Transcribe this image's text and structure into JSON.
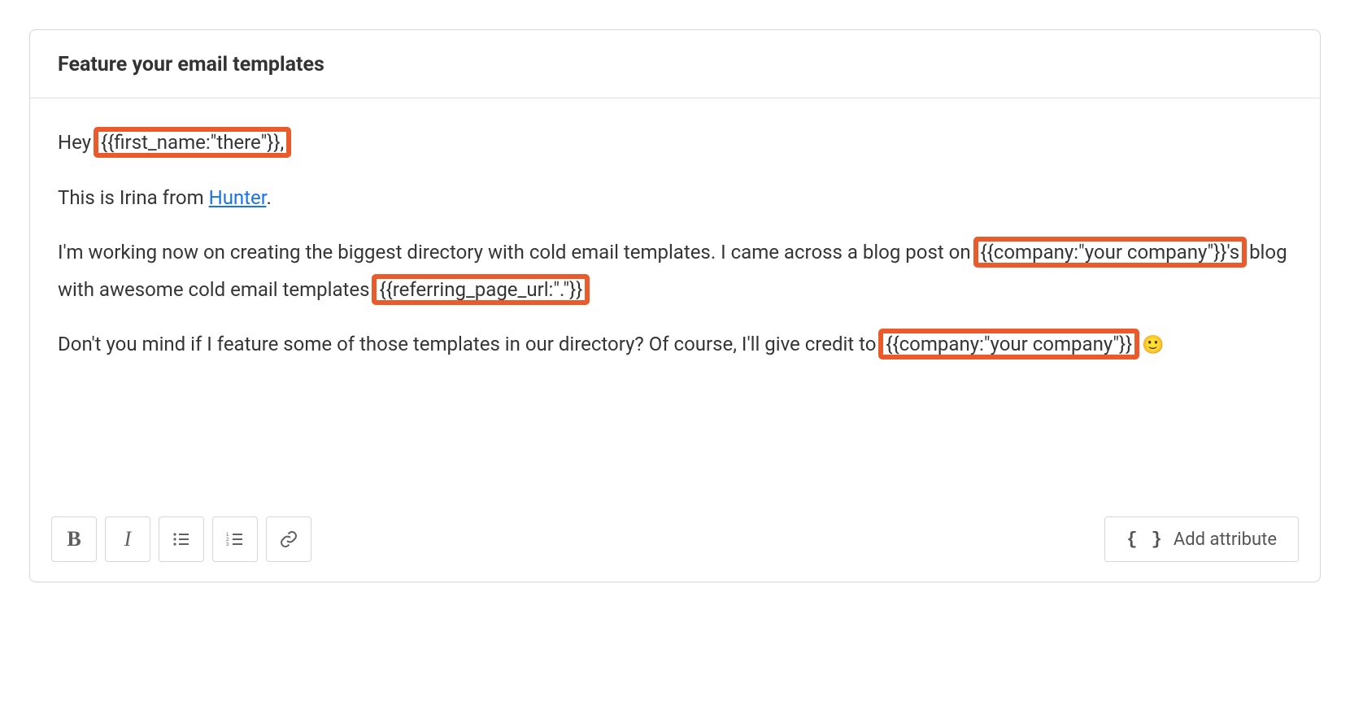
{
  "subject": "Feature your email templates",
  "body": {
    "greeting_prefix": "Hey ",
    "greeting_var": "{{first_name:\"there\"}},",
    "intro_prefix": "This is Irina from ",
    "intro_link_text": "Hunter",
    "intro_suffix": ".",
    "pitch_prefix": "I'm working now on creating the biggest directory with cold email templates. I came across a blog post on ",
    "pitch_company_var": "{{company:\"your company\"}}'s",
    "pitch_mid": " blog with awesome cold email templates ",
    "pitch_url_var": "{{referring_page_url:\".\"}}",
    "ask_prefix": "Don't you mind if I feature some of those templates in our directory? Of course, I'll give credit to ",
    "ask_company_var": "{{company:\"your company\"}}",
    "emoji": "🙂"
  },
  "toolbar": {
    "bold_label": "B",
    "italic_label": "I",
    "add_attribute_label": "Add attribute",
    "brace_glyph": "{ }"
  }
}
